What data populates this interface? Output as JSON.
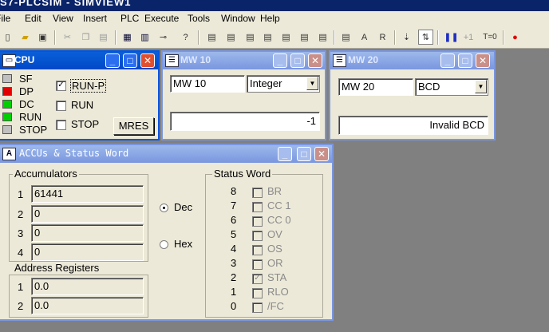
{
  "app": {
    "title": "S7-PLCSIM - SIMVIEW1"
  },
  "menu": [
    "File",
    "Edit",
    "View",
    "Insert",
    "PLC",
    "Execute",
    "Tools",
    "Window",
    "Help"
  ],
  "toolbar": {
    "icons": [
      "new-icon",
      "open-icon",
      "save-icon",
      "cut-icon",
      "copy-icon",
      "paste-icon",
      "cascade-icon",
      "tile-icon",
      "pin-icon",
      "help-icon",
      "insert-input-icon",
      "insert-output-icon",
      "insert-marker-icon",
      "insert-timer-icon",
      "insert-counter-icon",
      "insert-generic-icon",
      "insert-vertical-bits-icon",
      "insert-accu-icon",
      "insert-register-icon",
      "single-scan-icon",
      "continuous-scan-icon",
      "pause-icon",
      "plus-one-icon",
      "t0-icon",
      "breakpoint-icon"
    ],
    "plus_one": "+1",
    "t0": "T=0"
  },
  "cpu": {
    "title": "CPU",
    "leds": [
      {
        "label": "SF",
        "color": "#c0c0c0"
      },
      {
        "label": "DP",
        "color": "#e00000"
      },
      {
        "label": "DC",
        "color": "#00d000"
      },
      {
        "label": "RUN",
        "color": "#00d000"
      },
      {
        "label": "STOP",
        "color": "#c0c0c0"
      }
    ],
    "modes": [
      {
        "label": "RUN-P",
        "checked": "✓"
      },
      {
        "label": "RUN",
        "checked": ""
      },
      {
        "label": "STOP",
        "checked": ""
      }
    ],
    "mres": "MRES"
  },
  "mw10": {
    "title": "MW    10",
    "address": "MW   10",
    "format": "Integer",
    "value": "-1"
  },
  "mw20": {
    "title": "MW    20",
    "address": "MW   20",
    "format": "BCD",
    "value": "Invalid BCD"
  },
  "accu": {
    "title": "ACCUs & Status Word",
    "accumulators_label": "Accumulators",
    "accumulators": [
      {
        "n": "1",
        "value": "61441"
      },
      {
        "n": "2",
        "value": "0"
      },
      {
        "n": "3",
        "value": "0"
      },
      {
        "n": "4",
        "value": "0"
      }
    ],
    "address_label": "Address Registers",
    "address": [
      {
        "n": "1",
        "value": "0.0"
      },
      {
        "n": "2",
        "value": "0.0"
      }
    ],
    "radix": [
      {
        "label": "Dec",
        "selected": true
      },
      {
        "label": "Hex",
        "selected": false
      }
    ],
    "status_label": "Status Word",
    "status": [
      {
        "bit": "8",
        "name": "BR",
        "checked": ""
      },
      {
        "bit": "7",
        "name": "CC 1",
        "checked": ""
      },
      {
        "bit": "6",
        "name": "CC 0",
        "checked": ""
      },
      {
        "bit": "5",
        "name": "OV",
        "checked": ""
      },
      {
        "bit": "4",
        "name": "OS",
        "checked": ""
      },
      {
        "bit": "3",
        "name": "OR",
        "checked": ""
      },
      {
        "bit": "2",
        "name": "STA",
        "checked": "✓"
      },
      {
        "bit": "1",
        "name": "RLO",
        "checked": ""
      },
      {
        "bit": "0",
        "name": "/FC",
        "checked": ""
      }
    ]
  }
}
